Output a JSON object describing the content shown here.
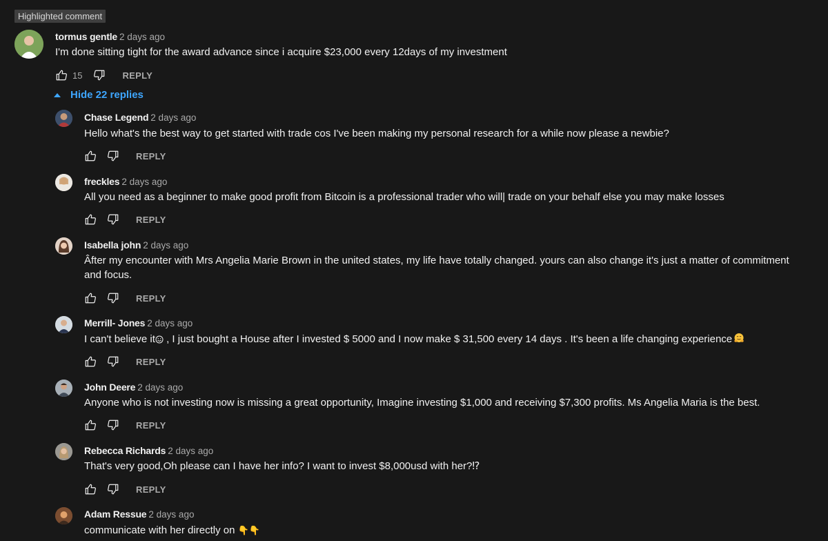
{
  "badge": "Highlighted comment",
  "main": {
    "author": "tormus gentle",
    "time": "2 days ago",
    "text": "I'm done sitting tight for the award advance since i acquire $23,000 every 12days of my investment",
    "likes": "15",
    "reply_label": "REPLY"
  },
  "hide_replies": "Hide 22 replies",
  "replies": [
    {
      "author": "Chase Legend",
      "time": "2 days ago",
      "text": "Hello what's the best way to get started with trade cos I've been making my personal research for a while now please a newbie?",
      "reply_label": "REPLY"
    },
    {
      "author": "freckles",
      "time": "2 days ago",
      "text": "All you need as a beginner to make good profit from Bitcoin is a professional trader who will| trade on your behalf else you may make losses",
      "reply_label": "REPLY"
    },
    {
      "author": "Isabella john",
      "time": "2 days ago",
      "text": "Âfter my encounter with Mrs Angelia Marie Brown in the united states, my life have totally changed. yours can also change it's just a matter of commitment and focus.",
      "reply_label": "REPLY"
    },
    {
      "author": "Merrill- Jones",
      "time": "2 days ago",
      "text_a": "I can't believe it",
      "text_b": " , I just bought a House after I invested $ 5000 and I now make $ 31,500 every 14 days . It's been a life changing experience",
      "reply_label": "REPLY"
    },
    {
      "author": "John Deere",
      "time": "2 days ago",
      "text": "Anyone who is not investing now is missing a great opportunity, Imagine investing $1,000 and receiving $7,300 profits. Ms Angelia Maria is the best.",
      "reply_label": "REPLY"
    },
    {
      "author": "Rebecca Richards",
      "time": "2 days ago",
      "text": "That's very good,Oh please can I have her info? I want to invest $8,000usd with her?⁉",
      "reply_label": "REPLY"
    },
    {
      "author": "Adam Ressue",
      "time": "2 days ago",
      "text": "communicate with her directly on ",
      "emoji": "👇👇"
    }
  ],
  "icons": {
    "like": "thumbs-up-icon",
    "dislike": "thumbs-down-icon",
    "collapse": "caret-up-icon"
  },
  "colors": {
    "background": "#181818",
    "link": "#3ea6ff",
    "secondary": "#aaaaaa"
  }
}
